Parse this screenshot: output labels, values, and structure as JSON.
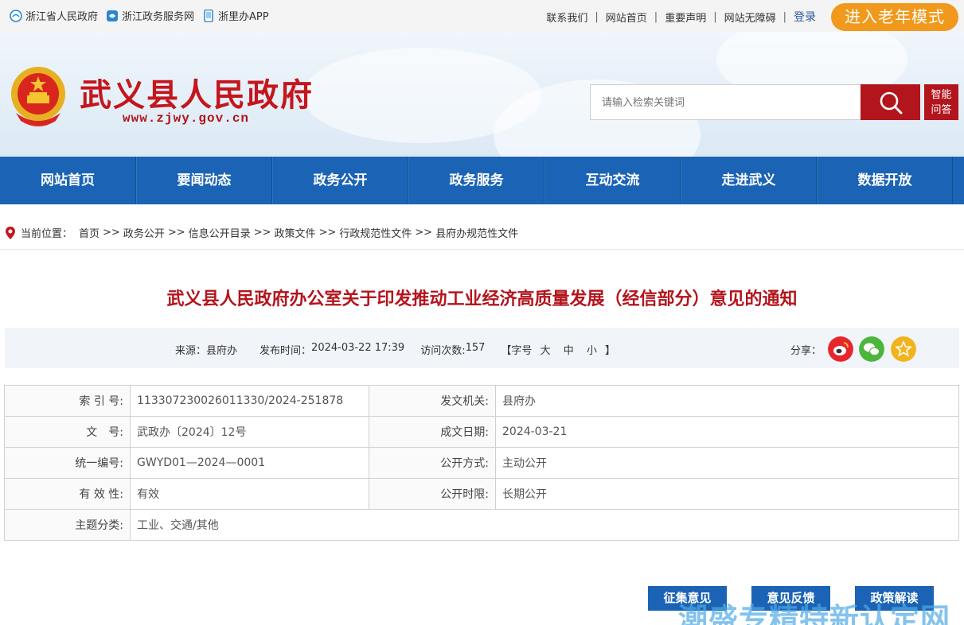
{
  "topbar": {
    "left_links": [
      {
        "label": "浙江省人民政府",
        "icon": "zhejiang-emblem-icon"
      },
      {
        "label": "浙江政务服务网",
        "icon": "zwfw-icon"
      },
      {
        "label": "浙里办APP",
        "icon": "mobile-app-icon"
      }
    ],
    "right_links": [
      "联系我们",
      "网站首页",
      "重要声明",
      "网站无障碍"
    ],
    "separator": "|",
    "login": "登录",
    "elder_mode": "进入老年模式"
  },
  "header": {
    "site_title": "武义县人民政府",
    "site_url": "www.zjwy.gov.cn",
    "search_placeholder": "请输入检索关键词",
    "ai_line1": "智能",
    "ai_line2": "问答"
  },
  "nav": [
    "网站首页",
    "要闻动态",
    "政务公开",
    "政务服务",
    "互动交流",
    "走进武义",
    "数据开放"
  ],
  "breadcrumb": {
    "label": "当前位置：",
    "items": [
      "首页",
      "政务公开",
      "信息公开目录",
      "政策文件",
      "行政规范性文件",
      "县府办规范性文件"
    ],
    "separator": ">>"
  },
  "article": {
    "title": "武义县人民政府办公室关于印发推动工业经济高质量发展（经信部分）意见的通知",
    "source_label": "来源：",
    "source": "县府办",
    "time_label": "发布时间：",
    "time": "2024-03-22 17:39",
    "visits_label": "访问次数:",
    "visits": "157",
    "fontsize_open": "【字号",
    "fontsize_large": "大",
    "fontsize_medium": "中",
    "fontsize_small": "小",
    "fontsize_close": "】",
    "share_label": "分享："
  },
  "info_table": {
    "index_label": "索 引 号:",
    "index_value": "113307230026011330/2024-251878",
    "issuer_label": "发文机关:",
    "issuer_value": "县府办",
    "docno_label": "文　号:",
    "docno_value": "武政办〔2024〕12号",
    "date_label": "成文日期:",
    "date_value": "2024-03-21",
    "uid_label": "统一编号:",
    "uid_value": "GWYD01—2024—0001",
    "open_mode_label": "公开方式:",
    "open_mode_value": "主动公开",
    "validity_label": "有 效 性:",
    "validity_value": "有效",
    "open_term_label": "公开时限:",
    "open_term_value": "长期公开",
    "topic_label": "主题分类:",
    "topic_value": "工业、交通/其他"
  },
  "actions": [
    "征集意见",
    "意见反馈",
    "政策解读"
  ],
  "watermark": "潮盛专精特新认定网",
  "colors": {
    "brand_red": "#b3151c",
    "nav_blue": "#1b63b4",
    "elder_orange": "#f0991c",
    "weibo_red": "#e6262c",
    "wechat_green": "#4bb53c",
    "star_yellow": "#f2b31c"
  }
}
